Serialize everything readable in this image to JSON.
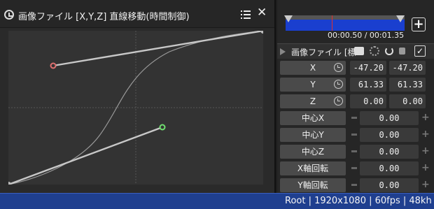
{
  "curve_editor": {
    "title": "画像ファイル [X,Y,Z] 直線移動(時間制御)",
    "icons": {
      "clock": "clock-icon",
      "menu": "list-icon",
      "close": "close-icon"
    },
    "control_points": {
      "start_color": "#cccccc",
      "handle1_color": "#e07070",
      "handle2_color": "#70e070",
      "end_color": "#cccccc"
    }
  },
  "timeline": {
    "time_readout": "00:00.50 / 00:01.35",
    "track_color": "#1a3fcf",
    "playhead_color": "#e03030"
  },
  "object": {
    "name": "画像ファイル [標",
    "add_label": "+",
    "checkbox_label": "✓"
  },
  "params": [
    {
      "label": "X",
      "values": [
        "-47.20",
        "-47.20"
      ]
    },
    {
      "label": "Y",
      "values": [
        "61.33",
        "61.33"
      ]
    },
    {
      "label": "Z",
      "values": [
        "0.00",
        "0.00"
      ]
    },
    {
      "label": "中心X",
      "value": "0.00"
    },
    {
      "label": "中心Y",
      "value": "0.00"
    },
    {
      "label": "中心Z",
      "value": "0.00"
    },
    {
      "label": "X軸回転",
      "value": "0.00"
    },
    {
      "label": "Y軸回転",
      "value": "0.00"
    }
  ],
  "statusbar": {
    "text": "Root  |  1920x1080  |  60fps  |  48kh"
  }
}
